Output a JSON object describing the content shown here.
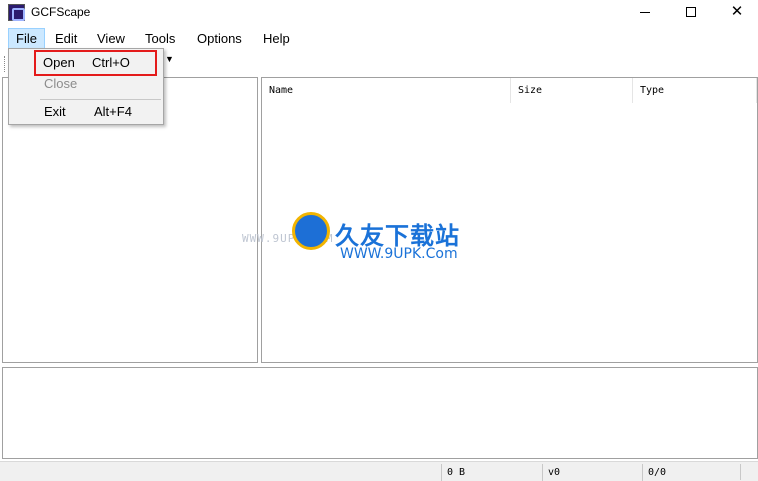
{
  "window": {
    "title": "GCFScape",
    "controls": {
      "minimize": "minimize-icon",
      "maximize": "maximize-icon",
      "close": "✕"
    }
  },
  "menubar": {
    "items": [
      "File",
      "Edit",
      "View",
      "Tools",
      "Options",
      "Help"
    ],
    "active": "File"
  },
  "file_menu": {
    "open_label": "Open",
    "open_shortcut": "Ctrl+O",
    "close_label": "Close",
    "exit_label": "Exit",
    "exit_shortcut": "Alt+F4"
  },
  "file_list": {
    "columns": [
      "Name",
      "Size",
      "Type"
    ]
  },
  "statusbar": {
    "size": "0 B",
    "version": "v0",
    "count": "0/0"
  },
  "watermark": {
    "url_text": "WWW.9UPK.COM",
    "cn_text": "久友下载站",
    "en_text": "WWW.9UPK.Com"
  },
  "colors": {
    "menu_active_bg": "#cce8ff",
    "highlight_outline": "#e41b1b",
    "disabled_text": "#8c8c8c",
    "watermark_blue": "#1a72d8"
  }
}
